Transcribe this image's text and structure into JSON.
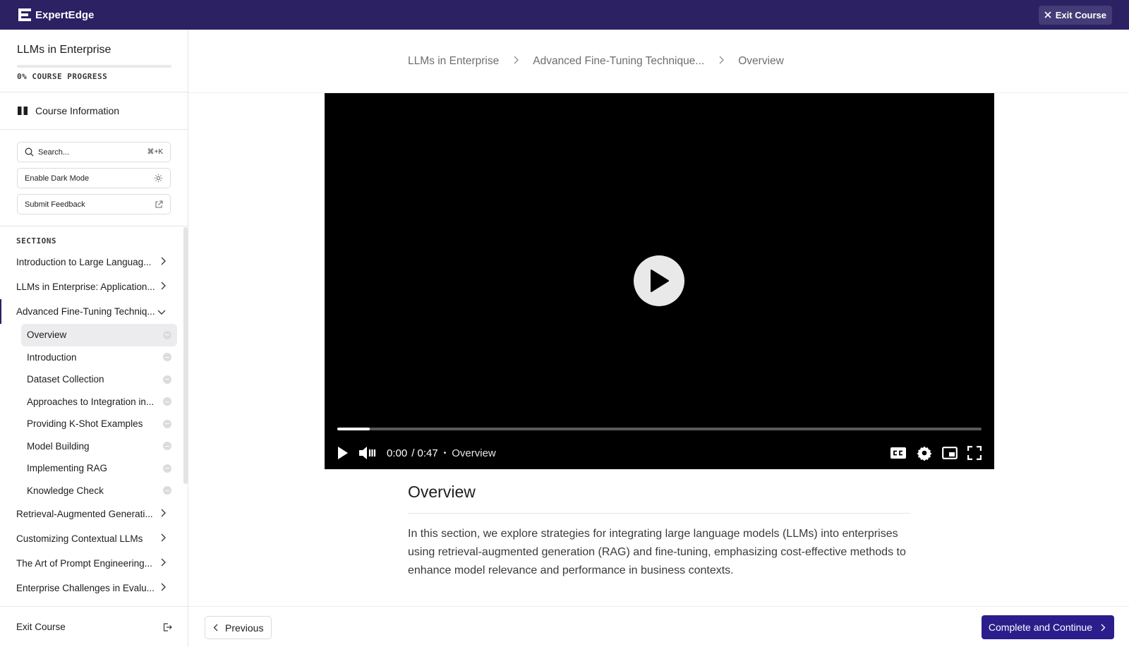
{
  "topbar": {
    "brand": "ExpertEdge",
    "exit_label": "Exit Course"
  },
  "sidebar": {
    "course_title": "LLMs in Enterprise",
    "progress_percent": 0,
    "progress_label": "0% COURSE PROGRESS",
    "course_info_label": "Course Information",
    "search_placeholder": "Search...",
    "search_shortcut": "⌘+K",
    "dark_mode_label": "Enable Dark Mode",
    "feedback_label": "Submit Feedback",
    "sections_label": "SECTIONS",
    "sections_before": [
      "Introduction to Large Languag...",
      "LLMs in Enterprise: Application...",
      "Advanced Fine-Tuning Techniq..."
    ],
    "lessons": [
      "Overview",
      "Introduction",
      "Dataset Collection",
      "Approaches to Integration in...",
      "Providing K-Shot Examples",
      "Model Building",
      "Implementing RAG",
      "Knowledge Check"
    ],
    "sections_after": [
      "Retrieval-Augmented Generati...",
      "Customizing Contextual LLMs",
      "The Art of Prompt Engineering...",
      "Enterprise Challenges in Evalu..."
    ],
    "exit_label": "Exit Course"
  },
  "breadcrumb": [
    "LLMs in Enterprise",
    "Advanced Fine-Tuning Technique...",
    "Overview"
  ],
  "video": {
    "current_time": "0:00",
    "duration": "/ 0:47",
    "separator": "•",
    "title": "Overview",
    "buffered_fraction": 0.05
  },
  "content": {
    "heading": "Overview",
    "body": "In this section, we explore strategies for integrating large language models (LLMs) into enterprises using retrieval-augmented generation (RAG) and fine-tuning, emphasizing cost-effective methods to enhance model relevance and performance in business contexts."
  },
  "footer": {
    "previous_label": "Previous",
    "next_label": "Complete and Continue"
  },
  "colors": {
    "brand": "#2b2163",
    "primary_button": "#2b1e8c"
  }
}
